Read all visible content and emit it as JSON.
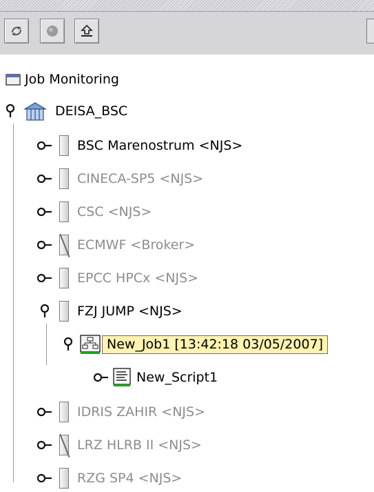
{
  "toolbar": {
    "buttons": [
      {
        "name": "refresh-icon"
      },
      {
        "name": "stop-icon"
      },
      {
        "name": "upload-icon"
      }
    ]
  },
  "tree": {
    "root": {
      "label": "Job Monitoring",
      "icon": "folder-icon"
    },
    "site": {
      "label": "DEISA_BSC",
      "icon": "home-icon"
    },
    "nodes": [
      {
        "label": "BSC Marenostrum <NJS>",
        "enabled": true,
        "expanded": false,
        "icon": "server-icon"
      },
      {
        "label": "CINECA-SP5 <NJS>",
        "enabled": false,
        "expanded": false,
        "icon": "server-icon"
      },
      {
        "label": "CSC <NJS>",
        "enabled": false,
        "expanded": false,
        "icon": "server-icon"
      },
      {
        "label": "ECMWF <Broker>",
        "enabled": false,
        "expanded": false,
        "icon": "broker-icon"
      },
      {
        "label": "EPCC HPCx <NJS>",
        "enabled": false,
        "expanded": false,
        "icon": "server-icon"
      },
      {
        "label": "FZJ JUMP <NJS>",
        "enabled": true,
        "expanded": true,
        "icon": "server-icon"
      }
    ],
    "job": {
      "label": "New_Job1 [13:42:18 03/05/2007]",
      "icon": "workflow-icon",
      "selected": true
    },
    "script": {
      "label": "New_Script1",
      "icon": "script-icon"
    },
    "more_nodes": [
      {
        "label": "IDRIS ZAHIR <NJS>",
        "enabled": false,
        "icon": "server-icon"
      },
      {
        "label": "LRZ HLRB II <NJS>",
        "enabled": false,
        "icon": "broker-icon"
      },
      {
        "label": "RZG SP4 <NJS>",
        "enabled": false,
        "icon": "server-icon"
      }
    ]
  },
  "colors": {
    "selection": "#fff3b0",
    "disabled_text": "#8c8c8c",
    "toolbar": "#d6d6d8"
  }
}
